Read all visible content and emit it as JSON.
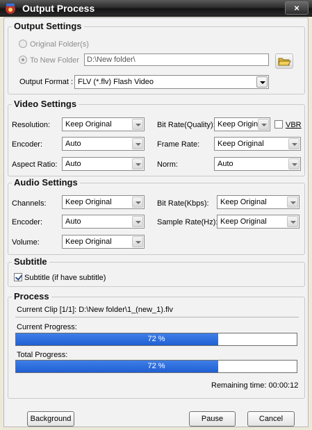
{
  "window": {
    "title": "Output Process",
    "close_icon": "×"
  },
  "output_settings": {
    "title": "Output Settings",
    "original_folder_label": "Original Folder(s)",
    "to_new_folder_label": "To New Folder",
    "folder_path": "D:\\New folder\\",
    "output_format_label": "Output Format :",
    "output_format_value": "FLV  (*.flv) Flash Video"
  },
  "video_settings": {
    "title": "Video Settings",
    "resolution_label": "Resolution:",
    "resolution_value": "Keep Original",
    "encoder_label": "Encoder:",
    "encoder_value": "Auto",
    "aspect_label": "Aspect Ratio:",
    "aspect_value": "Auto",
    "bitrate_label": "Bit Rate(Quality):",
    "bitrate_value": "Keep Original",
    "vbr_label": "VBR",
    "framerate_label": "Frame Rate:",
    "framerate_value": "Keep Original",
    "norm_label": "Norm:",
    "norm_value": "Auto"
  },
  "audio_settings": {
    "title": "Audio Settings",
    "channels_label": "Channels:",
    "channels_value": "Keep Original",
    "encoder_label": "Encoder:",
    "encoder_value": "Auto",
    "volume_label": "Volume:",
    "volume_value": "Keep Original",
    "bitrate_label": "Bit Rate(Kbps):",
    "bitrate_value": "Keep Original",
    "samplerate_label": "Sample Rate(Hz):",
    "samplerate_value": "Keep Original"
  },
  "subtitle": {
    "title": "Subtitle",
    "checkbox_label": "Subtitle (if have subtitle)",
    "checked": true
  },
  "process": {
    "title": "Process",
    "current_clip": "Current Clip [1/1]: D:\\New folder\\1_(new_1).flv",
    "current_progress_label": "Current Progress:",
    "current_progress_value": 0.72,
    "current_progress_text": "72 %",
    "total_progress_label": "Total Progress:",
    "total_progress_value": 0.72,
    "total_progress_text": "72 %",
    "remaining_time": "Remaining time: 00:00:12"
  },
  "buttons": {
    "background": "Background",
    "pause": "Pause",
    "cancel": "Cancel"
  },
  "colors": {
    "progress_fill": "#2a6be0",
    "titlebar": "#1e1e1e"
  }
}
